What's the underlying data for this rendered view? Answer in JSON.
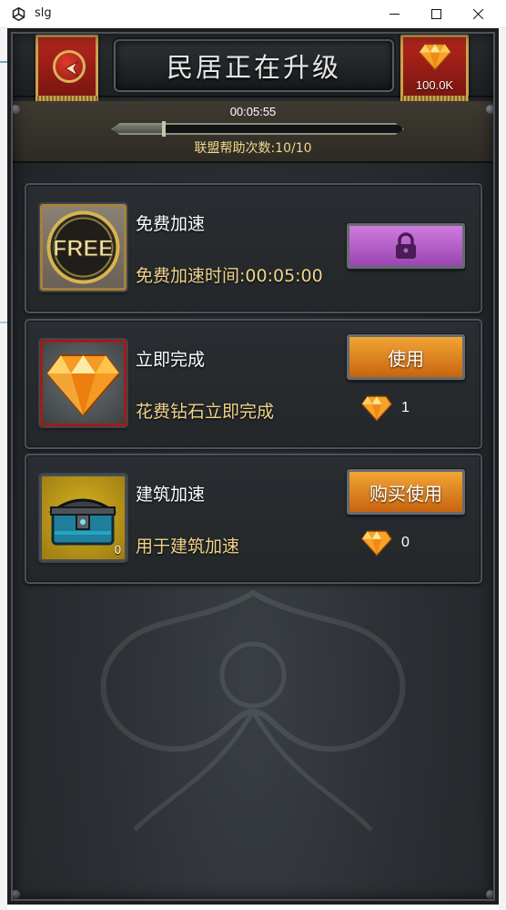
{
  "window": {
    "title": "slg",
    "minimize_icon": "minimize-icon",
    "maximize_icon": "maximize-icon",
    "close_icon": "close-icon"
  },
  "header": {
    "title": "民居正在升级",
    "back_icon": "back-arrow-icon",
    "gem_balance": "100.0K",
    "gem_icon": "gem-icon"
  },
  "timer": {
    "remaining": "00:05:55",
    "progress_fraction": 0.18,
    "alliance_help": "联盟帮助次数:10/10"
  },
  "items": [
    {
      "title": "免费加速",
      "desc": "免费加速时间:00:05:00",
      "icon": "free-icon",
      "icon_text": "FREE",
      "button_state": "locked",
      "button_icon": "lock-icon"
    },
    {
      "title": "立即完成",
      "desc": "花费钻石立即完成",
      "icon": "gem-icon",
      "button_label": "使用",
      "cost": "1"
    },
    {
      "title": "建筑加速",
      "desc": "用于建筑加速",
      "icon": "chest-icon",
      "owned_count": "0",
      "button_label": "购买使用",
      "cost": "0"
    }
  ],
  "colors": {
    "accent_gold": "#f1d48a",
    "button_orange": "#e08a22",
    "button_locked_purple": "#b25fc8",
    "frame_red": "#9c1f16"
  }
}
